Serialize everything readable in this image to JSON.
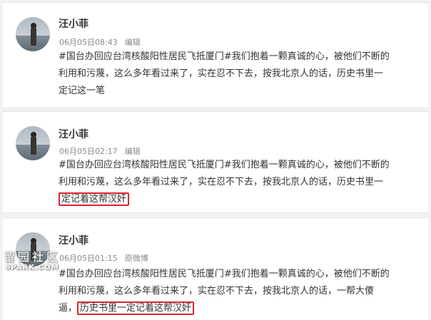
{
  "posts": [
    {
      "author": "汪小菲",
      "time": "06月05日08:43",
      "tag": "编辑",
      "lines": [
        "#国台办回应台湾核酸阳性居民飞抵厦门#我们抱着一颗真诚的心，被他们不断的",
        "利用和污蔑，这么多年看过来了，实在忍不下去，按我北京人的话，历史书里一",
        "定记这一笔"
      ]
    },
    {
      "author": "汪小菲",
      "time": "06月05日02:17",
      "tag": "编辑",
      "lines": [
        "#国台办回应台湾核酸阳性居民飞抵厦门#我们抱着一颗真诚的心，被他们不断的",
        "利用和污蔑，这么多年看过来了，实在忍不下去，按我北京人的话，历史书里一"
      ],
      "highlight": "定记着这帮汉奸"
    },
    {
      "author": "汪小菲",
      "time": "06月05日01:15",
      "tag": "原微博",
      "lines": [
        "#国台办回应台湾核酸阳性居民飞抵厦门#我们抱着一颗真诚的心，被他们不断的",
        "利用和污蔑，这么多年看过来了，实在忍不下去，按我北京人的话，一帮大傻"
      ],
      "line3_prefix": "逼，",
      "highlight": "历史书里一定记着这帮汉奸"
    }
  ],
  "watermark": {
    "cn": "留园社区",
    "en": "6PARK.COM"
  },
  "colors": {
    "highlight_border": "#d9262b",
    "meta_text": "#8a8a8a",
    "body_text": "#333333"
  }
}
